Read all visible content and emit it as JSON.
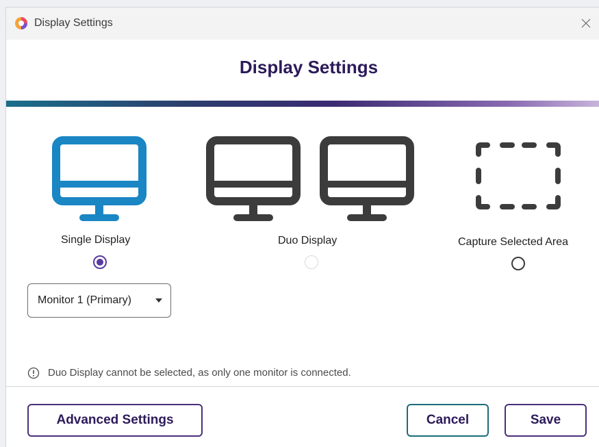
{
  "window": {
    "title": "Display Settings"
  },
  "header": {
    "heading": "Display Settings"
  },
  "options": {
    "single": {
      "label": "Single Display",
      "selected": true,
      "enabled": true
    },
    "duo": {
      "label": "Duo Display",
      "selected": false,
      "enabled": false
    },
    "capture": {
      "label": "Capture Selected Area",
      "selected": false,
      "enabled": true
    }
  },
  "monitor_select": {
    "value": "Monitor 1 (Primary)"
  },
  "info": {
    "message": "Duo Display cannot be selected, as only one monitor is connected."
  },
  "buttons": {
    "advanced": "Advanced Settings",
    "cancel": "Cancel",
    "save": "Save"
  },
  "icons": {
    "app": "app-logo-icon",
    "close": "close-icon",
    "single": "single-monitor-icon",
    "duo": "dual-monitor-icon",
    "capture": "selection-area-icon",
    "info": "info-icon",
    "caret": "chevron-down-icon"
  },
  "colors": {
    "accent": "#5a3a9e",
    "heading": "#2b1b5a",
    "single_icon": "#1a86c4",
    "duo_icon": "#3c3c3c",
    "cancel_border": "#1b6b78"
  }
}
